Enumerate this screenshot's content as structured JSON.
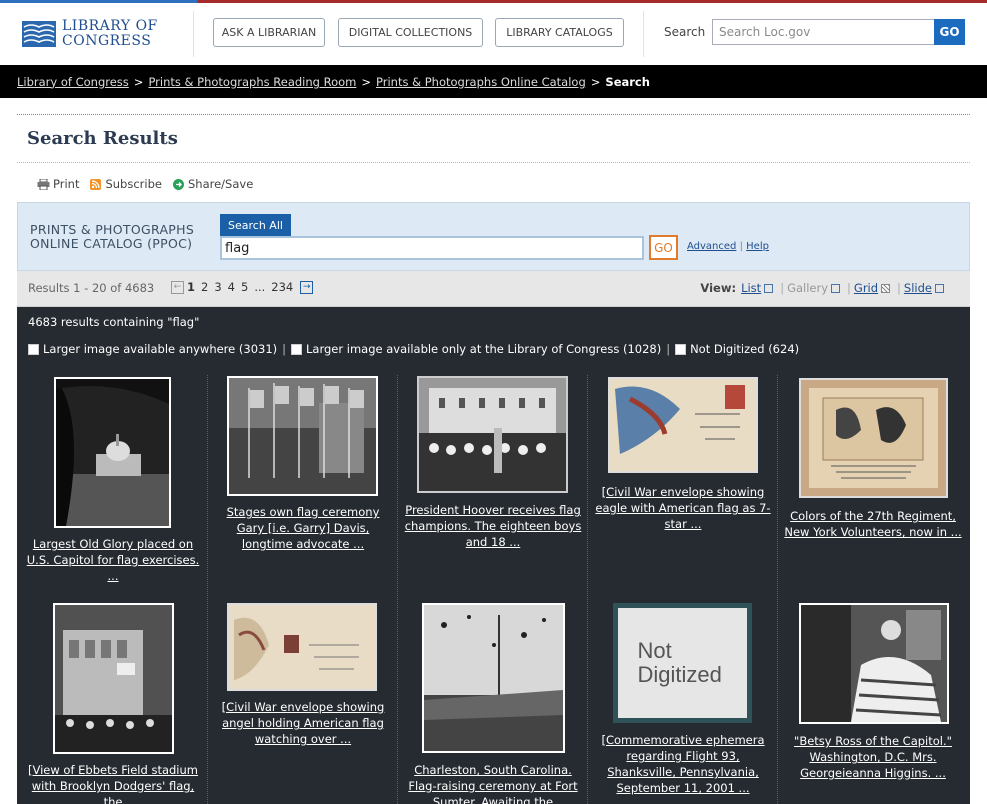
{
  "header": {
    "logo_line1": "LIBRARY OF",
    "logo_line2": "CONGRESS",
    "buttons": [
      "ASK A LIBRARIAN",
      "DIGITAL COLLECTIONS",
      "LIBRARY CATALOGS"
    ],
    "search_label": "Search",
    "search_placeholder": "Search Loc.gov",
    "go_label": "GO"
  },
  "breadcrumb": {
    "items": [
      "Library of Congress",
      "Prints & Photographs Reading Room",
      "Prints & Photographs Online Catalog"
    ],
    "current": "Search"
  },
  "page_title": "Search Results",
  "tools": [
    "Print",
    "Subscribe",
    "Share/Save"
  ],
  "search_panel": {
    "catalog_line1": "PRINTS & PHOTOGRAPHS",
    "catalog_line2": "ONLINE CATALOG (PPOC)",
    "tab_label": "Search All",
    "query": "flag",
    "go_label": "GO",
    "advanced": "Advanced",
    "help": "Help"
  },
  "results_bar": {
    "count_text": "Results 1 - 20 of 4683",
    "pages": [
      "1",
      "2",
      "3",
      "4",
      "5",
      "...",
      "234"
    ],
    "view_label": "View:",
    "views": [
      "List",
      "Gallery",
      "Grid",
      "Slide"
    ]
  },
  "results": {
    "heading": "4683 results containing \"flag\"",
    "filters": [
      "Larger image available anywhere (3031)",
      "Larger image available only at the Library of Congress (1028)",
      "Not Digitized (624)"
    ],
    "not_digitized_text": "Not Digitized",
    "items": [
      {
        "caption": "Largest Old Glory placed on U.S. Capitol for flag exercises. ..."
      },
      {
        "caption": "Stages own flag ceremony Gary [i.e. Garry] Davis, longtime advocate ..."
      },
      {
        "caption": "President Hoover receives flag champions. The eighteen boys and 18 ..."
      },
      {
        "caption": "[Civil War envelope showing eagle with American flag as 7-star ..."
      },
      {
        "caption": "Colors of the 27th Regiment, New York Volunteers, now in ..."
      },
      {
        "caption": "[View of Ebbets Field stadium with Brooklyn Dodgers' flag, the"
      },
      {
        "caption": "[Civil War envelope showing angel holding American flag watching over ..."
      },
      {
        "caption": "Charleston, South Carolina. Flag-raising ceremony at Fort Sumter. Awaiting the"
      },
      {
        "caption": "[Commemorative ephemera regarding Flight 93, Shanksville, Pennsylvania, September 11, 2001 ..."
      },
      {
        "caption": "\"Betsy Ross of the Capitol.\" Washington, D.C. Mrs. Georgeieanna Higgins. ..."
      }
    ]
  }
}
